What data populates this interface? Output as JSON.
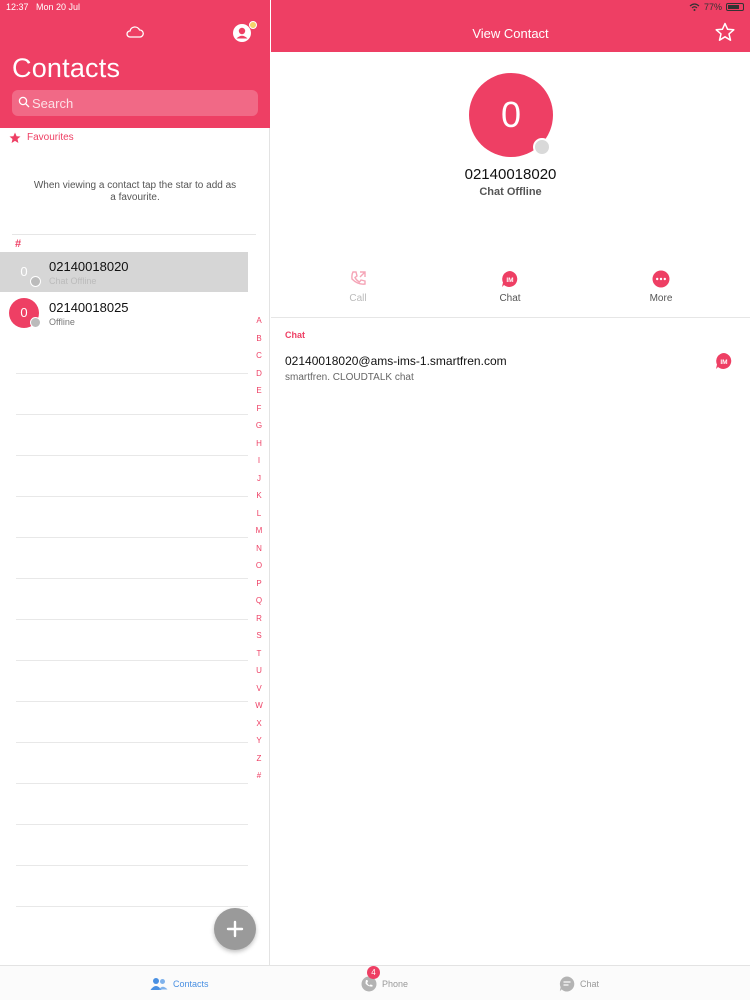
{
  "status_bar": {
    "time": "12:37",
    "date": "Mon 20 Jul",
    "battery": "77%"
  },
  "left": {
    "title": "Contacts",
    "search": {
      "placeholder": "Search",
      "value": ""
    },
    "favourites_label": "Favourites",
    "favourites_hint": "When viewing a contact tap the star to add as a favourite.",
    "section_header": "#",
    "contacts": [
      {
        "initial": "0",
        "name": "02140018020",
        "status": "Chat Offline",
        "selected": true
      },
      {
        "initial": "0",
        "name": "02140018025",
        "status": "Offline",
        "selected": false
      }
    ],
    "alpha_index": [
      "A",
      "B",
      "C",
      "D",
      "E",
      "F",
      "G",
      "H",
      "I",
      "J",
      "K",
      "L",
      "M",
      "N",
      "O",
      "P",
      "Q",
      "R",
      "S",
      "T",
      "U",
      "V",
      "W",
      "X",
      "Y",
      "Z",
      "#"
    ]
  },
  "right": {
    "title": "View Contact",
    "avatar_initial": "0",
    "number": "02140018020",
    "chat_status": "Chat Offline",
    "actions": [
      {
        "label": "Call",
        "icon": "phone-call-icon",
        "enabled": false
      },
      {
        "label": "Chat",
        "icon": "im-chat-icon",
        "enabled": true
      },
      {
        "label": "More",
        "icon": "more-dots-icon",
        "enabled": true
      }
    ],
    "chat_section_label": "Chat",
    "chat_address": "02140018020@ams-ims-1.smartfren.com",
    "chat_sub": "smartfren. CLOUDTALK chat"
  },
  "tabbar": {
    "tabs": [
      {
        "label": "Contacts",
        "icon": "contacts-icon",
        "active": true
      },
      {
        "label": "Phone",
        "icon": "phone-icon",
        "active": false,
        "badge": "4"
      },
      {
        "label": "Chat",
        "icon": "chat-bubble-icon",
        "active": false
      }
    ]
  },
  "colors": {
    "accent": "#ee3f64",
    "tab_active": "#4a90e2"
  }
}
